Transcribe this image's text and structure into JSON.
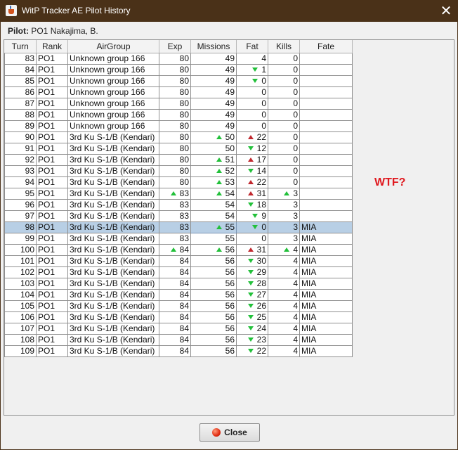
{
  "window": {
    "title": "WitP Tracker AE Pilot History",
    "close_glyph": "✕"
  },
  "pilot": {
    "label": "Pilot:",
    "value": "PO1  Nakajima, B."
  },
  "table": {
    "columns": [
      "Turn",
      "Rank",
      "AirGroup",
      "Exp",
      "Missions",
      "Fat",
      "Kills",
      "Fate"
    ],
    "selected_turn": "98",
    "rows": [
      {
        "turn": "83",
        "rank": "PO1",
        "airgroup": "Unknown group 166",
        "exp": "80",
        "exp_arrow": "",
        "missions": "49",
        "missions_arrow": "",
        "fat": "4",
        "fat_arrow": "",
        "kills": "0",
        "kills_arrow": "",
        "fate": ""
      },
      {
        "turn": "84",
        "rank": "PO1",
        "airgroup": "Unknown group 166",
        "exp": "80",
        "exp_arrow": "",
        "missions": "49",
        "missions_arrow": "",
        "fat": "1",
        "fat_arrow": "down",
        "kills": "0",
        "kills_arrow": "",
        "fate": ""
      },
      {
        "turn": "85",
        "rank": "PO1",
        "airgroup": "Unknown group 166",
        "exp": "80",
        "exp_arrow": "",
        "missions": "49",
        "missions_arrow": "",
        "fat": "0",
        "fat_arrow": "down",
        "kills": "0",
        "kills_arrow": "",
        "fate": ""
      },
      {
        "turn": "86",
        "rank": "PO1",
        "airgroup": "Unknown group 166",
        "exp": "80",
        "exp_arrow": "",
        "missions": "49",
        "missions_arrow": "",
        "fat": "0",
        "fat_arrow": "",
        "kills": "0",
        "kills_arrow": "",
        "fate": ""
      },
      {
        "turn": "87",
        "rank": "PO1",
        "airgroup": "Unknown group 166",
        "exp": "80",
        "exp_arrow": "",
        "missions": "49",
        "missions_arrow": "",
        "fat": "0",
        "fat_arrow": "",
        "kills": "0",
        "kills_arrow": "",
        "fate": ""
      },
      {
        "turn": "88",
        "rank": "PO1",
        "airgroup": "Unknown group 166",
        "exp": "80",
        "exp_arrow": "",
        "missions": "49",
        "missions_arrow": "",
        "fat": "0",
        "fat_arrow": "",
        "kills": "0",
        "kills_arrow": "",
        "fate": ""
      },
      {
        "turn": "89",
        "rank": "PO1",
        "airgroup": "Unknown group 166",
        "exp": "80",
        "exp_arrow": "",
        "missions": "49",
        "missions_arrow": "",
        "fat": "0",
        "fat_arrow": "",
        "kills": "0",
        "kills_arrow": "",
        "fate": ""
      },
      {
        "turn": "90",
        "rank": "PO1",
        "airgroup": "3rd Ku S-1/B (Kendari)",
        "exp": "80",
        "exp_arrow": "",
        "missions": "50",
        "missions_arrow": "up",
        "fat": "22",
        "fat_arrow": "up-red",
        "kills": "0",
        "kills_arrow": "",
        "fate": ""
      },
      {
        "turn": "91",
        "rank": "PO1",
        "airgroup": "3rd Ku S-1/B (Kendari)",
        "exp": "80",
        "exp_arrow": "",
        "missions": "50",
        "missions_arrow": "",
        "fat": "12",
        "fat_arrow": "down",
        "kills": "0",
        "kills_arrow": "",
        "fate": ""
      },
      {
        "turn": "92",
        "rank": "PO1",
        "airgroup": "3rd Ku S-1/B (Kendari)",
        "exp": "80",
        "exp_arrow": "",
        "missions": "51",
        "missions_arrow": "up",
        "fat": "17",
        "fat_arrow": "up-red",
        "kills": "0",
        "kills_arrow": "",
        "fate": ""
      },
      {
        "turn": "93",
        "rank": "PO1",
        "airgroup": "3rd Ku S-1/B (Kendari)",
        "exp": "80",
        "exp_arrow": "",
        "missions": "52",
        "missions_arrow": "up",
        "fat": "14",
        "fat_arrow": "down",
        "kills": "0",
        "kills_arrow": "",
        "fate": ""
      },
      {
        "turn": "94",
        "rank": "PO1",
        "airgroup": "3rd Ku S-1/B (Kendari)",
        "exp": "80",
        "exp_arrow": "",
        "missions": "53",
        "missions_arrow": "up",
        "fat": "22",
        "fat_arrow": "up-red",
        "kills": "0",
        "kills_arrow": "",
        "fate": ""
      },
      {
        "turn": "95",
        "rank": "PO1",
        "airgroup": "3rd Ku S-1/B (Kendari)",
        "exp": "83",
        "exp_arrow": "up",
        "missions": "54",
        "missions_arrow": "up",
        "fat": "31",
        "fat_arrow": "up-red",
        "kills": "3",
        "kills_arrow": "up",
        "fate": ""
      },
      {
        "turn": "96",
        "rank": "PO1",
        "airgroup": "3rd Ku S-1/B (Kendari)",
        "exp": "83",
        "exp_arrow": "",
        "missions": "54",
        "missions_arrow": "",
        "fat": "18",
        "fat_arrow": "down",
        "kills": "3",
        "kills_arrow": "",
        "fate": ""
      },
      {
        "turn": "97",
        "rank": "PO1",
        "airgroup": "3rd Ku S-1/B (Kendari)",
        "exp": "83",
        "exp_arrow": "",
        "missions": "54",
        "missions_arrow": "",
        "fat": "9",
        "fat_arrow": "down",
        "kills": "3",
        "kills_arrow": "",
        "fate": ""
      },
      {
        "turn": "98",
        "rank": "PO1",
        "airgroup": "3rd Ku S-1/B (Kendari)",
        "exp": "83",
        "exp_arrow": "",
        "missions": "55",
        "missions_arrow": "up",
        "fat": "0",
        "fat_arrow": "down",
        "kills": "3",
        "kills_arrow": "",
        "fate": "MIA"
      },
      {
        "turn": "99",
        "rank": "PO1",
        "airgroup": "3rd Ku S-1/B (Kendari)",
        "exp": "83",
        "exp_arrow": "",
        "missions": "55",
        "missions_arrow": "",
        "fat": "0",
        "fat_arrow": "",
        "kills": "3",
        "kills_arrow": "",
        "fate": "MIA"
      },
      {
        "turn": "100",
        "rank": "PO1",
        "airgroup": "3rd Ku S-1/B (Kendari)",
        "exp": "84",
        "exp_arrow": "up",
        "missions": "56",
        "missions_arrow": "up",
        "fat": "31",
        "fat_arrow": "up-red",
        "kills": "4",
        "kills_arrow": "up",
        "fate": "MIA"
      },
      {
        "turn": "101",
        "rank": "PO1",
        "airgroup": "3rd Ku S-1/B (Kendari)",
        "exp": "84",
        "exp_arrow": "",
        "missions": "56",
        "missions_arrow": "",
        "fat": "30",
        "fat_arrow": "down",
        "kills": "4",
        "kills_arrow": "",
        "fate": "MIA"
      },
      {
        "turn": "102",
        "rank": "PO1",
        "airgroup": "3rd Ku S-1/B (Kendari)",
        "exp": "84",
        "exp_arrow": "",
        "missions": "56",
        "missions_arrow": "",
        "fat": "29",
        "fat_arrow": "down",
        "kills": "4",
        "kills_arrow": "",
        "fate": "MIA"
      },
      {
        "turn": "103",
        "rank": "PO1",
        "airgroup": "3rd Ku S-1/B (Kendari)",
        "exp": "84",
        "exp_arrow": "",
        "missions": "56",
        "missions_arrow": "",
        "fat": "28",
        "fat_arrow": "down",
        "kills": "4",
        "kills_arrow": "",
        "fate": "MIA"
      },
      {
        "turn": "104",
        "rank": "PO1",
        "airgroup": "3rd Ku S-1/B (Kendari)",
        "exp": "84",
        "exp_arrow": "",
        "missions": "56",
        "missions_arrow": "",
        "fat": "27",
        "fat_arrow": "down",
        "kills": "4",
        "kills_arrow": "",
        "fate": "MIA"
      },
      {
        "turn": "105",
        "rank": "PO1",
        "airgroup": "3rd Ku S-1/B (Kendari)",
        "exp": "84",
        "exp_arrow": "",
        "missions": "56",
        "missions_arrow": "",
        "fat": "26",
        "fat_arrow": "down",
        "kills": "4",
        "kills_arrow": "",
        "fate": "MIA"
      },
      {
        "turn": "106",
        "rank": "PO1",
        "airgroup": "3rd Ku S-1/B (Kendari)",
        "exp": "84",
        "exp_arrow": "",
        "missions": "56",
        "missions_arrow": "",
        "fat": "25",
        "fat_arrow": "down",
        "kills": "4",
        "kills_arrow": "",
        "fate": "MIA"
      },
      {
        "turn": "107",
        "rank": "PO1",
        "airgroup": "3rd Ku S-1/B (Kendari)",
        "exp": "84",
        "exp_arrow": "",
        "missions": "56",
        "missions_arrow": "",
        "fat": "24",
        "fat_arrow": "down",
        "kills": "4",
        "kills_arrow": "",
        "fate": "MIA"
      },
      {
        "turn": "108",
        "rank": "PO1",
        "airgroup": "3rd Ku S-1/B (Kendari)",
        "exp": "84",
        "exp_arrow": "",
        "missions": "56",
        "missions_arrow": "",
        "fat": "23",
        "fat_arrow": "down",
        "kills": "4",
        "kills_arrow": "",
        "fate": "MIA"
      },
      {
        "turn": "109",
        "rank": "PO1",
        "airgroup": "3rd Ku S-1/B (Kendari)",
        "exp": "84",
        "exp_arrow": "",
        "missions": "56",
        "missions_arrow": "",
        "fat": "22",
        "fat_arrow": "down",
        "kills": "4",
        "kills_arrow": "",
        "fate": "MIA"
      }
    ]
  },
  "annotation": {
    "text": "WTF?",
    "color": "#e0191f"
  },
  "buttons": {
    "close_label": "Close"
  },
  "colors": {
    "titlebar": "#4a3118",
    "selected_row": "#b8cfe5",
    "arrow_up": "#22c03a",
    "arrow_up_red": "#c0272d"
  }
}
